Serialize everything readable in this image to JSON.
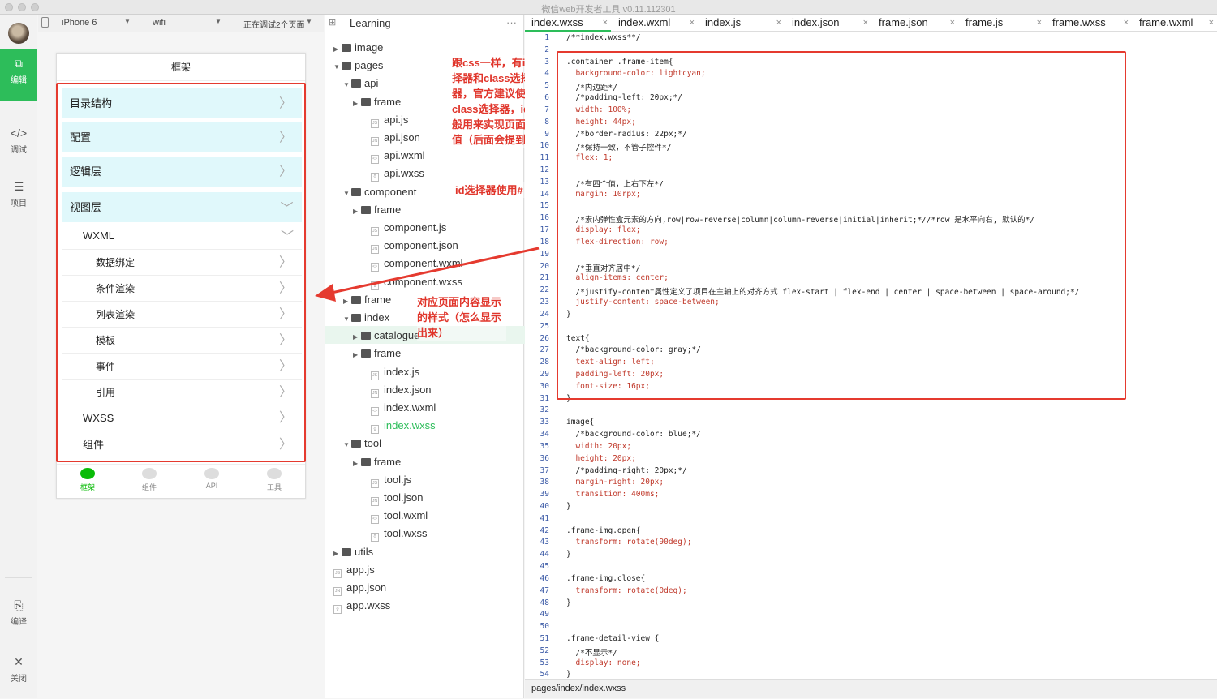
{
  "window": {
    "title": "微信web开发者工具 v0.11.112301"
  },
  "leftbar": {
    "items": [
      {
        "icon": "edit-icon",
        "label": "编辑"
      },
      {
        "icon": "debug-icon",
        "label": "调试"
      },
      {
        "icon": "project-icon",
        "label": "项目"
      },
      {
        "icon": "compile-icon",
        "label": "编译"
      },
      {
        "icon": "close-icon",
        "label": "关闭"
      }
    ]
  },
  "simulator": {
    "device": "iPhone 6",
    "network": "wifi",
    "debug_pages": "正在调试2个页面"
  },
  "phone": {
    "title": "框架",
    "items": [
      "目录结构",
      "配置",
      "逻辑层",
      "视图层"
    ],
    "wxml_label": "WXML",
    "wxml_subitems": [
      "数据绑定",
      "条件渲染",
      "列表渲染",
      "模板",
      "事件",
      "引用"
    ],
    "wxss_label": "WXSS",
    "component_label": "组件",
    "tabbar": [
      "框架",
      "组件",
      "API",
      "工具"
    ]
  },
  "files": {
    "project": "Learning",
    "tree": [
      {
        "d": 0,
        "type": "folder",
        "name": "image",
        "exp": false
      },
      {
        "d": 0,
        "type": "folder",
        "name": "pages",
        "exp": true
      },
      {
        "d": 1,
        "type": "folder",
        "name": "api",
        "exp": true
      },
      {
        "d": 2,
        "type": "folder",
        "name": "frame",
        "exp": false
      },
      {
        "d": 2,
        "type": "file",
        "ext": "JS",
        "name": "api.js"
      },
      {
        "d": 2,
        "type": "file",
        "ext": "JN",
        "name": "api.json"
      },
      {
        "d": 2,
        "type": "file",
        "ext": "<>",
        "name": "api.wxml"
      },
      {
        "d": 2,
        "type": "file",
        "ext": "{}",
        "name": "api.wxss"
      },
      {
        "d": 1,
        "type": "folder",
        "name": "component",
        "exp": true
      },
      {
        "d": 2,
        "type": "folder",
        "name": "frame",
        "exp": false
      },
      {
        "d": 2,
        "type": "file",
        "ext": "JS",
        "name": "component.js"
      },
      {
        "d": 2,
        "type": "file",
        "ext": "JN",
        "name": "component.json"
      },
      {
        "d": 2,
        "type": "file",
        "ext": "<>",
        "name": "component.wxml"
      },
      {
        "d": 2,
        "type": "file",
        "ext": "{}",
        "name": "component.wxss"
      },
      {
        "d": 1,
        "type": "folder",
        "name": "frame",
        "exp": false
      },
      {
        "d": 1,
        "type": "folder",
        "name": "index",
        "exp": true
      },
      {
        "d": 2,
        "type": "folder",
        "name": "catalogue",
        "exp": false,
        "sel": true
      },
      {
        "d": 2,
        "type": "folder",
        "name": "frame",
        "exp": false
      },
      {
        "d": 2,
        "type": "file",
        "ext": "JS",
        "name": "index.js"
      },
      {
        "d": 2,
        "type": "file",
        "ext": "JN",
        "name": "index.json"
      },
      {
        "d": 2,
        "type": "file",
        "ext": "<>",
        "name": "index.wxml"
      },
      {
        "d": 2,
        "type": "file",
        "ext": "{}",
        "name": "index.wxss",
        "active": true
      },
      {
        "d": 1,
        "type": "folder",
        "name": "tool",
        "exp": true
      },
      {
        "d": 2,
        "type": "folder",
        "name": "frame",
        "exp": false
      },
      {
        "d": 2,
        "type": "file",
        "ext": "JS",
        "name": "tool.js"
      },
      {
        "d": 2,
        "type": "file",
        "ext": "JN",
        "name": "tool.json"
      },
      {
        "d": 2,
        "type": "file",
        "ext": "<>",
        "name": "tool.wxml"
      },
      {
        "d": 2,
        "type": "file",
        "ext": "{}",
        "name": "tool.wxss"
      },
      {
        "d": 0,
        "type": "folder",
        "name": "utils",
        "exp": false
      },
      {
        "d": 0,
        "type": "file",
        "ext": "JS",
        "name": "app.js"
      },
      {
        "d": 0,
        "type": "file",
        "ext": "JN",
        "name": "app.json"
      },
      {
        "d": 0,
        "type": "file",
        "ext": "{}",
        "name": "app.wxss"
      }
    ]
  },
  "annotations": {
    "note1": "跟css一样，有id选择器和class选择器，官方建议使用class选择器，id一般用来实现页面传值（后面会提到）",
    "note2": "id选择器使用#",
    "note3": "对应页面内容显示的样式（怎么显示出来）"
  },
  "editor": {
    "tabs": [
      "index.wxss",
      "index.wxml",
      "index.js",
      "index.json",
      "frame.json",
      "frame.js",
      "frame.wxss",
      "frame.wxml"
    ],
    "active_tab": "index.wxss",
    "lines": [
      "/**index.wxss**/",
      "",
      ".container .frame-item{",
      "  background-color: lightcyan;",
      "  /*内边距*/",
      "  /*padding-left: 20px;*/",
      "  width: 100%;",
      "  height: 44px;",
      "  /*border-radius: 22px;*/",
      "  /*保持一致，不管子控件*/",
      "  flex: 1;",
      "",
      "  /*有四个值，上右下左*/",
      "  margin: 10rpx;",
      "",
      "  /*素内弹性盒元素的方向,row|row-reverse|column|column-reverse|initial|inherit;*//*row 是水平向右, 默认的*/",
      "  display: flex;",
      "  flex-direction: row;",
      "",
      "  /*垂直对齐居中*/",
      "  align-items: center;",
      "  /*justify-content属性定义了项目在主轴上的对齐方式 flex-start | flex-end | center | space-between | space-around;*/",
      "  justify-content: space-between;",
      "}",
      "",
      "text{",
      "  /*background-color: gray;*/",
      "  text-align: left;",
      "  padding-left: 20px;",
      "  font-size: 16px;",
      "}",
      "",
      "image{",
      "  /*background-color: blue;*/",
      "  width: 20px;",
      "  height: 20px;",
      "  /*padding-right: 20px;*/",
      "  margin-right: 20px;",
      "  transition: 400ms;",
      "}",
      "",
      ".frame-img.open{",
      "  transform: rotate(90deg);",
      "}",
      "",
      ".frame-img.close{",
      "  transform: rotate(0deg);",
      "}",
      "",
      "",
      ".frame-detail-view {",
      "  /*不显示*/",
      "  display: none;",
      "}"
    ]
  },
  "status": {
    "path": "pages/index/index.wxss"
  },
  "colors": {
    "accent": "#2dbd5a",
    "annotation": "#e53a2f",
    "item_bg": "#e0f8fb"
  }
}
